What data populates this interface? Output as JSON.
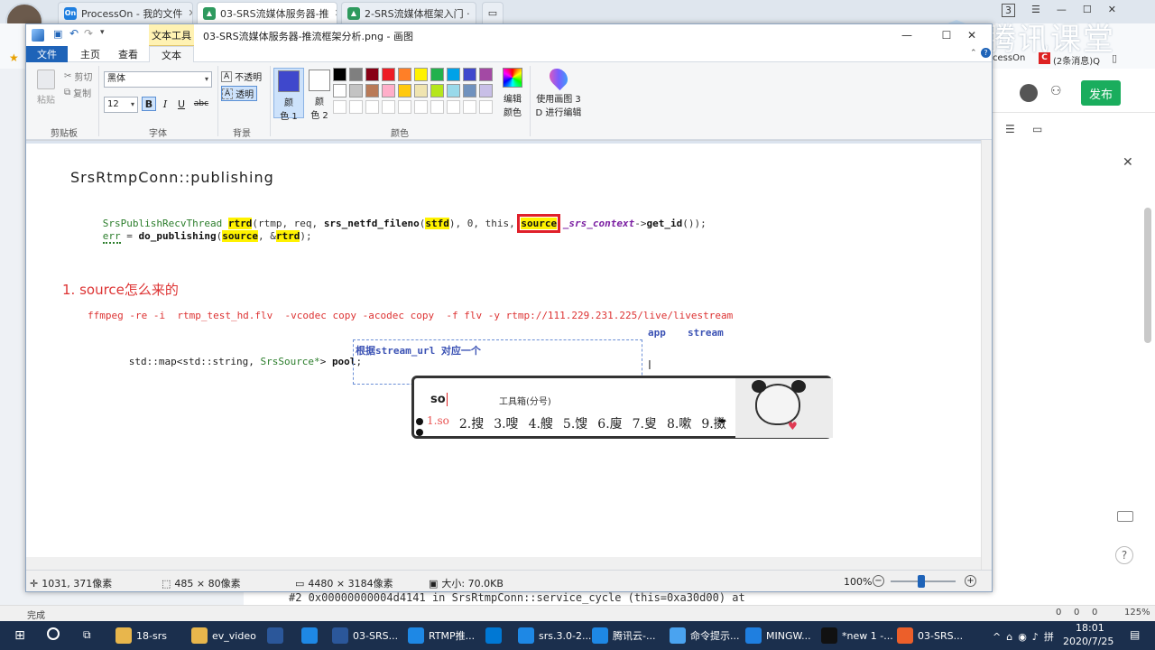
{
  "browser": {
    "tabs": [
      {
        "label": "ProcessOn - 我的文件",
        "favicon": "On"
      },
      {
        "label": "03-SRS流媒体服务器-推",
        "active": true
      },
      {
        "label": "2-SRS流媒体框架入门 ·"
      }
    ],
    "bookmarks_right": {
      "left": "cessOn",
      "right": "(2条消息)Q"
    },
    "publish_label": "发布"
  },
  "watermark": {
    "text": "腾讯课堂"
  },
  "paint": {
    "title": "03-SRS流媒体服务器-推流框架分析.png - 画图",
    "context_tab": "文本工具",
    "tabs": {
      "file": "文件",
      "home": "主页",
      "view": "查看",
      "text": "文本"
    },
    "clipboard": {
      "paste": "粘贴",
      "cut": "剪切",
      "copy": "复制",
      "label": "剪贴板"
    },
    "font": {
      "family": "黑体",
      "size": "12",
      "label": "字体",
      "bold": "B",
      "italic": "I",
      "underline": "U",
      "strike": "abc"
    },
    "background": {
      "opaque": "不透明",
      "transparent": "透明",
      "label": "背景"
    },
    "colors": {
      "color1_line1": "颜",
      "color1_line2": "色 1",
      "color2_line1": "颜",
      "color2_line2": "色 2",
      "edit_line1": "编辑",
      "edit_line2": "颜色",
      "paint3d_line1": "使用画图 3",
      "paint3d_line2": "D 进行编辑",
      "label": "颜色",
      "color1": "#3f48cc",
      "color2": "#ffffff",
      "palette_row1": [
        "#000000",
        "#7f7f7f",
        "#880015",
        "#ed1c24",
        "#ff7f27",
        "#fff200",
        "#22b14c",
        "#00a2e8",
        "#3f48cc",
        "#a349a4"
      ],
      "palette_row2": [
        "#ffffff",
        "#c3c3c3",
        "#b97a57",
        "#ffaec9",
        "#ffc90e",
        "#efe4b0",
        "#b5e61d",
        "#99d9ea",
        "#7092be",
        "#c8bfe7"
      ]
    },
    "canvas": {
      "heading": "SrsRtmpConn::publishing",
      "code1_a": "SrsPublishRecvThread ",
      "code1_rtrd": "rtrd",
      "code1_b": "(rtmp, req, ",
      "code1_fn": "srs_netfd_fileno",
      "code1_c": "(",
      "code1_stfd": "stfd",
      "code1_d": "), 0, this, ",
      "code1_source": "source",
      "code1_ctx": " _srs_context",
      "code1_e": "->",
      "code1_getid": "get_id",
      "code1_f": "());",
      "code2_err": "err",
      "code2_eq": " = ",
      "code2_fn": "do_publishing",
      "code2_a": "(",
      "code2_source": "source",
      "code2_b": ", &",
      "code2_rtrd": "rtrd",
      "code2_c": ");",
      "section_title": "1. source怎么来的",
      "ffmpeg_cmd": "ffmpeg -re -i  rtmp_test_hd.flv  -vcodec copy -acodec copy  -f flv -y rtmp://111.229.231.225/live/livestream",
      "app_label": "app",
      "stream_label": "stream",
      "map_a": "std::map<std::string, ",
      "map_type": "SrsSource*",
      "map_b": "> ",
      "map_pool": "pool",
      "map_c": ";",
      "textbox": "根据stream_url 对应一个"
    },
    "ime": {
      "input": "so",
      "toolbox": "工具箱(分号)",
      "first": "1.so",
      "candidates": [
        "2.搜",
        "3.嗖",
        "4.艘",
        "5.馊",
        "6.廋",
        "7.叟",
        "8.嗽",
        "9.擞"
      ]
    },
    "status": {
      "cursor": "1031, 371像素",
      "selection": "485 × 80像素",
      "image_size": "4480 × 3184像素",
      "file_size": "大小: 70.0KB",
      "zoom": "100%"
    }
  },
  "web": {
    "gdb_line": "#2  0x00000000004d4141 in SrsRtmpConn::service_cycle (this=0xa30d00) at"
  },
  "system_status": {
    "left": "完成",
    "zoom": "125%",
    "counters": [
      "0",
      "0",
      "0"
    ]
  },
  "taskbar": {
    "items": [
      "18-srs",
      "ev_video",
      "03-SRS...",
      "RTMP推...",
      "srs.3.0-2...",
      "腾讯云-...",
      "命令提示...",
      "MINGW...",
      "*new 1 -...",
      "03-SRS..."
    ],
    "time": "18:01",
    "date": "2020/7/25"
  }
}
